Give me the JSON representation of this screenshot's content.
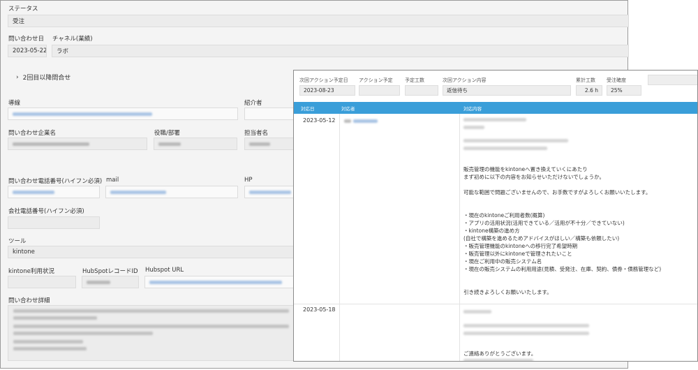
{
  "back": {
    "status": {
      "label": "ステータス",
      "value": "受注"
    },
    "inquiry_date": {
      "label": "問い合わせ日",
      "value": "2023-05-22"
    },
    "channel": {
      "label": "チャネル(業績)",
      "value": "ラボ"
    },
    "followup_section": "2回目以降問合せ",
    "route_label": "導線",
    "introducer_label": "紹介者",
    "company_label": "問い合わせ企業名",
    "position_label": "役職/部署",
    "contact_person_label": "担当者名",
    "phone_label": "問い合わせ電話番号(ハイフン必須)",
    "mail_label": "mail",
    "hp_label": "HP",
    "company_phone_label": "会社電話番号(ハイフン必須)",
    "tool": {
      "label": "ツール",
      "value": "kintone"
    },
    "kintone_usage_label": "kintone利用状況",
    "hubspot_record_label": "HubSpotレコードID",
    "hubspot_url_label": "Hubspot URL",
    "inquiry_detail_label": "問い合わせ詳細"
  },
  "front": {
    "next_action_date": {
      "label": "次回アクション予定日",
      "value": "2023-08-23"
    },
    "action_plan": {
      "label": "アクション予定",
      "value": ""
    },
    "planned_hours": {
      "label": "予定工数",
      "value": ""
    },
    "next_action_content": {
      "label": "次回アクション内容",
      "value": "返信待ち"
    },
    "total_hours": {
      "label": "累計工数",
      "value": "2.6 h"
    },
    "order_probability": {
      "label": "受注確度",
      "value": "25%"
    },
    "table": {
      "headers": [
        "対応日",
        "対応者",
        "対応内容"
      ],
      "rows": [
        {
          "date": "2023-05-12",
          "lines": [
            "販売管理の機能をkintoneへ置き換えていくにあたり",
            "まず初めに以下の内容をお知らせいただけないでしょうか。",
            "",
            "可能な範囲で問題ございませんので、お手数ですがよろしくお願いいたします。",
            "",
            "",
            "・現在のkintoneご利用者数(概算)",
            "・アプリの活用状況(活用できている／活用が不十分／できていない)",
            "・kintone構築の進め方",
            "  (自社で構築を進めるためアドバイスがほしい／構築も依頼したい)",
            "・販売管理機能のkintoneへの移行完了希望時期",
            "・販売管理以外にkintoneで管理されたいこと",
            "・現在ご利用中の販売システム名",
            "・現在の販売システムの利用用途(見積、受発注、在庫、契約、債券・債務管理など)",
            "",
            "",
            "引き続きよろしくお願いいたします。"
          ]
        },
        {
          "date": "2023-05-18",
          "lines": [
            "ご連絡ありがとうございます。"
          ]
        }
      ]
    }
  }
}
